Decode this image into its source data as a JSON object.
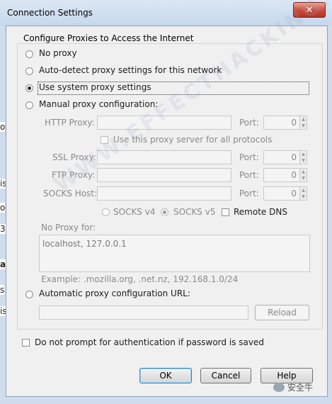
{
  "window": {
    "title": "Connection Settings",
    "close_glyph": "✕"
  },
  "background_fragments": [
    "o",
    "is",
    "o",
    "3",
    "a",
    "s",
    "is"
  ],
  "group": {
    "legend": "Configure Proxies to Access the Internet"
  },
  "proxy_options": {
    "no_proxy": "No proxy",
    "auto_detect": "Auto-detect proxy settings for this network",
    "system": "Use system proxy settings",
    "manual": "Manual proxy configuration:",
    "selected": "system"
  },
  "manual": {
    "http_label": "HTTP Proxy:",
    "ssl_label": "SSL Proxy:",
    "ftp_label": "FTP Proxy:",
    "socks_label": "SOCKS Host:",
    "port_label": "Port:",
    "http_port": "0",
    "ssl_port": "0",
    "ftp_port": "0",
    "socks_port": "0",
    "same_proxy_label": "Use this proxy server for all protocols",
    "socks_v4": "SOCKS v4",
    "socks_v5": "SOCKS v5",
    "remote_dns": "Remote DNS"
  },
  "no_proxy_for": {
    "label": "No Proxy for:",
    "value": "localhost, 127.0.0.1",
    "example": "Example: .mozilla.org, .net.nz, 192.168.1.0/24"
  },
  "auto_config": {
    "label": "Automatic proxy configuration URL:",
    "reload": "Reload"
  },
  "no_prompt_label": "Do not prompt for authentication if password is saved",
  "buttons": {
    "ok": "OK",
    "cancel": "Cancel",
    "help": "Help"
  },
  "watermark": {
    "text": "WWW.EFFECTHACKING.COM",
    "logo_text": "安全牛"
  }
}
